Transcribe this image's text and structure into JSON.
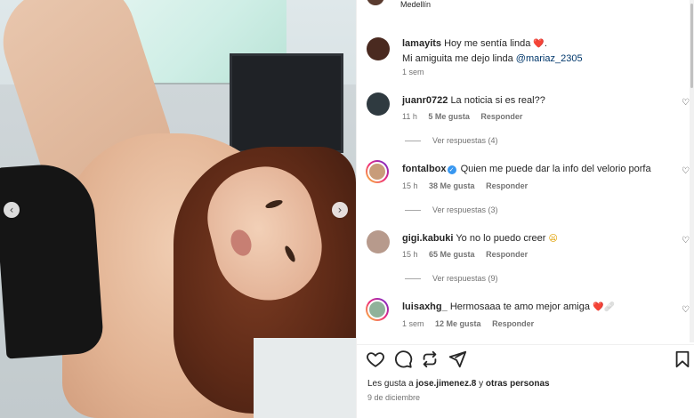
{
  "post": {
    "location": "Medellín",
    "caption": {
      "username": "lamayits",
      "line1": "Hoy me sentía linda",
      "line1_emoji": "❤️",
      "line1_end": ".",
      "line2": "Mi amiguita me dejo linda",
      "mention": "@mariaz_2305",
      "time": "1 sem"
    }
  },
  "comments": [
    {
      "username": "juanr0722",
      "text": "La noticia si es real??",
      "time": "11 h",
      "likes": "5 Me gusta",
      "reply": "Responder",
      "replies": "Ver respuestas (4)",
      "verified": false
    },
    {
      "username": "fontalbox",
      "text": "Quien me puede dar la info del velorio porfa",
      "time": "15 h",
      "likes": "38 Me gusta",
      "reply": "Responder",
      "replies": "Ver respuestas (3)",
      "verified": true
    },
    {
      "username": "gigi.kabuki",
      "text": "Yo no lo puedo creer",
      "emoji": "😦",
      "time": "15 h",
      "likes": "65 Me gusta",
      "reply": "Responder",
      "replies": "Ver respuestas (9)",
      "verified": false
    },
    {
      "username": "luisaxhg_",
      "text": "Hermosaaa te amo mejor amiga",
      "emoji": "❤️🩹",
      "time": "1 sem",
      "likes": "12 Me gusta",
      "reply": "Responder",
      "verified": false
    }
  ],
  "footer": {
    "likes_prefix": "Les gusta a",
    "likes_user": "jose.jimenez.8",
    "likes_and": "y",
    "likes_others": "otras personas",
    "date": "9 de diciembre"
  },
  "icons": {
    "like": "heart-icon",
    "comment": "comment-icon",
    "share": "repost-icon",
    "send": "send-icon",
    "save": "bookmark-icon"
  }
}
